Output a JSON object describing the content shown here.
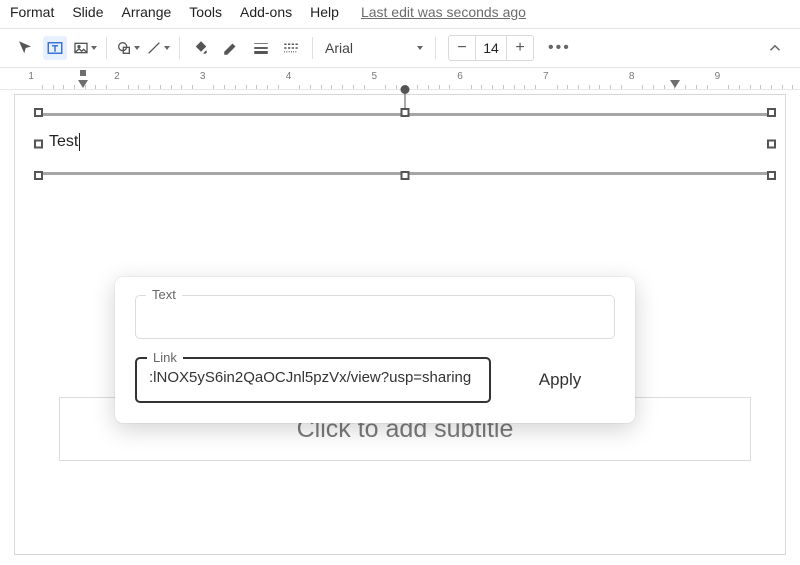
{
  "menu": {
    "items": [
      "Format",
      "Slide",
      "Arrange",
      "Tools",
      "Add-ons",
      "Help"
    ],
    "edit_status": "Last edit was seconds ago"
  },
  "toolbar": {
    "font_name": "Arial",
    "font_size": "14",
    "minus": "−",
    "plus": "+"
  },
  "ruler": {
    "labels": [
      "1",
      "2",
      "3",
      "4",
      "5",
      "6",
      "7",
      "8",
      "9"
    ]
  },
  "title_box": {
    "text": "Test"
  },
  "subtitle_placeholder": "Click to add subtitle",
  "link_popup": {
    "text_label": "Text",
    "text_value": "",
    "link_label": "Link",
    "link_value": ":lNOX5yS6in2QaOCJnl5pzVx/view?usp=sharing",
    "apply_label": "Apply"
  }
}
